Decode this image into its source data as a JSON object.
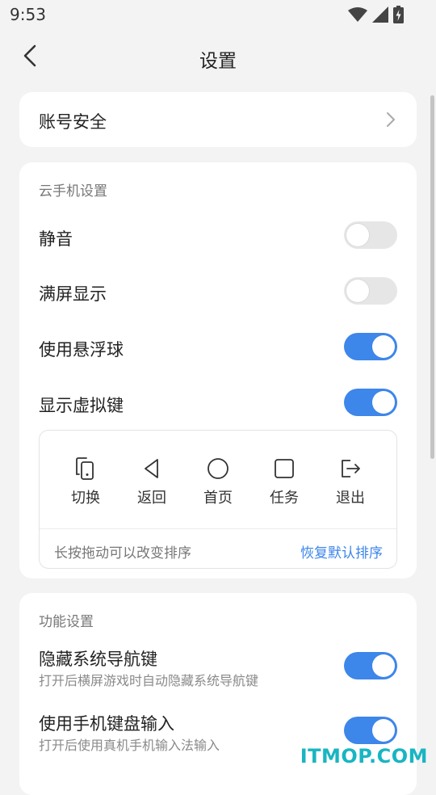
{
  "status": {
    "time": "9:53"
  },
  "header": {
    "title": "设置"
  },
  "account": {
    "label": "账号安全"
  },
  "cloud": {
    "title": "云手机设置",
    "mute": {
      "label": "静音",
      "on": false
    },
    "fullscreen": {
      "label": "满屏显示",
      "on": false
    },
    "floatball": {
      "label": "使用悬浮球",
      "on": true
    },
    "vkeys": {
      "label": "显示虚拟键",
      "on": true
    },
    "keys": [
      "切换",
      "返回",
      "首页",
      "任务",
      "退出"
    ],
    "hint": "长按拖动可以改变排序",
    "reset": "恢复默认排序"
  },
  "func": {
    "title": "功能设置",
    "hidenav": {
      "label": "隐藏系统导航键",
      "desc": "打开后横屏游戏时自动隐藏系统导航键",
      "on": true
    },
    "kbinput": {
      "label": "使用手机键盘输入",
      "desc": "打开后使用真机手机输入法输入",
      "on": true
    }
  },
  "watermark": "ITMOP.COM",
  "colors": {
    "accent": "#3d86ea",
    "toggle_off": "#e6e6e6",
    "background": "#f3f3f3"
  },
  "icons": [
    "wifi-icon",
    "signal-icon",
    "battery-icon",
    "back-arrow-icon",
    "chevron-right-icon",
    "switch-phone-icon",
    "back-triangle-icon",
    "home-circle-icon",
    "task-square-icon",
    "exit-icon"
  ]
}
